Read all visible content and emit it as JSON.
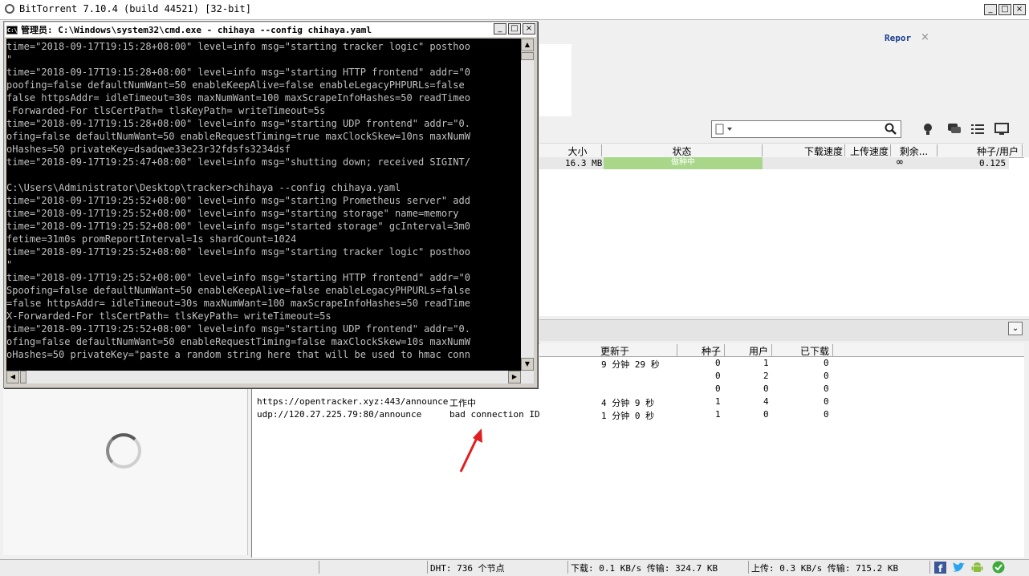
{
  "bt_window": {
    "title": "BitTorrent 7.10.4  (build 44521) [32-bit]",
    "min_label": "_",
    "max_label": "□",
    "close_label": "×"
  },
  "report_tab": {
    "label": "Repor",
    "close": "×"
  },
  "torrent_columns": [
    "大小",
    "状态",
    "下载速度",
    "上传速度",
    "剩余...",
    "种子/用户"
  ],
  "torrent_row": {
    "size": "16.3 MB",
    "status": "做种中",
    "remaining": "∞",
    "seeds_peers": "0.125"
  },
  "tracker_columns": [
    "更新于",
    "种子",
    "用户",
    "已下载"
  ],
  "tracker_rows": [
    {
      "name": "",
      "status": "",
      "update": "9 分钟 29 秒",
      "seeds": "0",
      "peers": "1",
      "downloaded": "0"
    },
    {
      "name": "",
      "status": "",
      "update": "",
      "seeds": "0",
      "peers": "2",
      "downloaded": "0"
    },
    {
      "name": "",
      "status": "",
      "update": "",
      "seeds": "0",
      "peers": "0",
      "downloaded": "0"
    },
    {
      "name": "https://opentracker.xyz:443/announce",
      "status": "工作中",
      "update": "4 分钟 9 秒",
      "seeds": "1",
      "peers": "4",
      "downloaded": "0"
    },
    {
      "name": "udp://120.27.225.79:80/announce",
      "status": "bad connection ID",
      "update": "1 分钟 0 秒",
      "seeds": "1",
      "peers": "0",
      "downloaded": "0"
    }
  ],
  "statusbar": {
    "dht": "DHT: 736 个节点",
    "download": "下载: 0.1 KB/s 传输: 324.7 KB",
    "upload": "上传: 0.3 KB/s 传输: 715.2 KB"
  },
  "cmd_window": {
    "title": "管理员: C:\\Windows\\system32\\cmd.exe - chihaya  --config chihaya.yaml",
    "lines": [
      "time=\"2018-09-17T19:15:28+08:00\" level=info msg=\"starting tracker logic\" posthoo",
      "\"",
      "time=\"2018-09-17T19:15:28+08:00\" level=info msg=\"starting HTTP frontend\" addr=\"0",
      "poofing=false defaultNumWant=50 enableKeepAlive=false enableLegacyPHPURLs=false",
      "false httpsAddr= idleTimeout=30s maxNumWant=100 maxScrapeInfoHashes=50 readTimeo",
      "-Forwarded-For tlsCertPath= tlsKeyPath= writeTimeout=5s",
      "time=\"2018-09-17T19:15:28+08:00\" level=info msg=\"starting UDP frontend\" addr=\"0.",
      "ofing=false defaultNumWant=50 enableRequestTiming=true maxClockSkew=10ns maxNumW",
      "oHashes=50 privateKey=dsadqwe33e23r32fdsfs3234dsf",
      "time=\"2018-09-17T19:25:47+08:00\" level=info msg=\"shutting down; received SIGINT/",
      "",
      "C:\\Users\\Administrator\\Desktop\\tracker>chihaya --config chihaya.yaml",
      "time=\"2018-09-17T19:25:52+08:00\" level=info msg=\"starting Prometheus server\" add",
      "time=\"2018-09-17T19:25:52+08:00\" level=info msg=\"starting storage\" name=memory",
      "time=\"2018-09-17T19:25:52+08:00\" level=info msg=\"started storage\" gcInterval=3m0",
      "fetime=31m0s promReportInterval=1s shardCount=1024",
      "time=\"2018-09-17T19:25:52+08:00\" level=info msg=\"starting tracker logic\" posthoo",
      "\"",
      "time=\"2018-09-17T19:25:52+08:00\" level=info msg=\"starting HTTP frontend\" addr=\"0",
      "Spoofing=false defaultNumWant=50 enableKeepAlive=false enableLegacyPHPURLs=false",
      "=false httpsAddr= idleTimeout=30s maxNumWant=100 maxScrapeInfoHashes=50 readTime",
      "X-Forwarded-For tlsCertPath= tlsKeyPath= writeTimeout=5s",
      "time=\"2018-09-17T19:25:52+08:00\" level=info msg=\"starting UDP frontend\" addr=\"0.",
      "ofing=false defaultNumWant=50 enableRequestTiming=false maxClockSkew=10s maxNumW",
      "oHashes=50 privateKey=\"paste a random string here that will be used to hmac conn"
    ]
  },
  "icons": {
    "search": "search-icon",
    "bulb": "bulb-icon",
    "chat": "chat-icon",
    "list": "list-icon",
    "monitor": "monitor-icon",
    "facebook": "facebook-icon",
    "twitter": "twitter-icon",
    "android": "android-icon",
    "check": "check-icon"
  },
  "colors": {
    "seeding_status": "#a8d78a",
    "report_tab_text": "#1a3d8f",
    "arrow": "#e02020",
    "console_bg": "#000000",
    "console_text": "#c0c0c0"
  }
}
